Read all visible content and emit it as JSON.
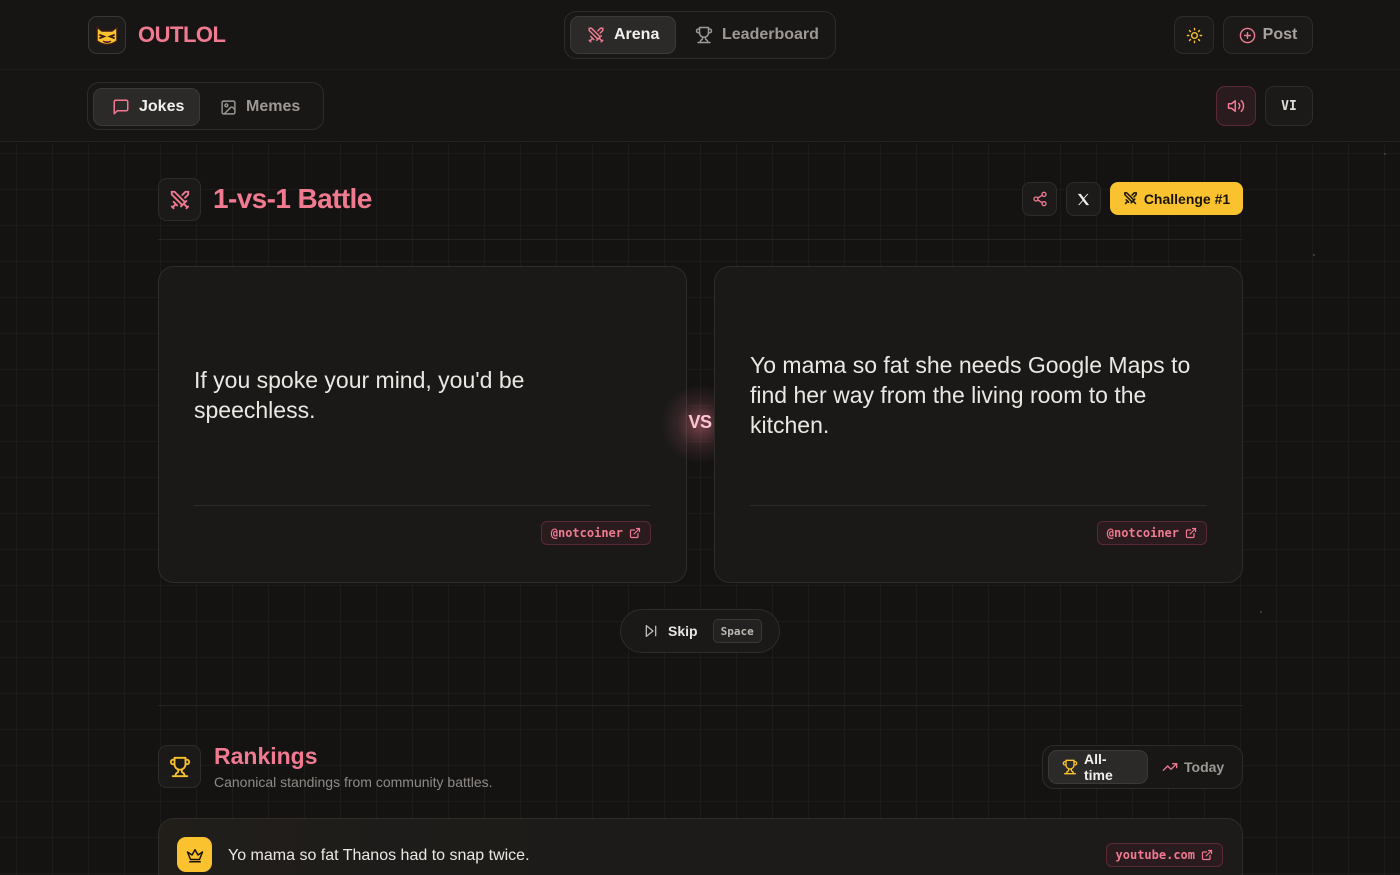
{
  "header": {
    "brand": "OUTLOL",
    "nav": [
      {
        "label": "Arena",
        "active": true,
        "icon": "crossed-swords-icon"
      },
      {
        "label": "Leaderboard",
        "active": false,
        "icon": "trophy-icon"
      }
    ],
    "theme_icon": "sun-icon",
    "post_label": "Post"
  },
  "subheader": {
    "tabs": [
      {
        "label": "Jokes",
        "active": true,
        "icon": "message-square-icon"
      },
      {
        "label": "Memes",
        "active": false,
        "icon": "image-icon"
      }
    ],
    "sound_icon": "volume-icon",
    "language": "VI"
  },
  "battle": {
    "title": "1-vs-1 Battle",
    "challenge_label": "Challenge #1",
    "vs_label": "VS",
    "left": {
      "text": "If you spoke your mind, you'd be speechless.",
      "author": "@notcoiner"
    },
    "right": {
      "text": "Yo mama so fat she needs Google Maps to find her way from the living room to the kitchen.",
      "author": "@notcoiner"
    },
    "skip_label": "Skip",
    "skip_key": "Space"
  },
  "rankings": {
    "title": "Rankings",
    "subtitle": "Canonical standings from community battles.",
    "periods": [
      {
        "label": "All-time",
        "active": true,
        "icon": "trophy-icon"
      },
      {
        "label": "Today",
        "active": false,
        "icon": "trending-up-icon"
      }
    ],
    "entries": [
      {
        "text": "Yo mama so fat Thanos had to snap twice.",
        "source": "youtube.com"
      }
    ]
  },
  "colors": {
    "accent": "#f07a90",
    "gold": "#f9c22e",
    "background": "#141312"
  }
}
